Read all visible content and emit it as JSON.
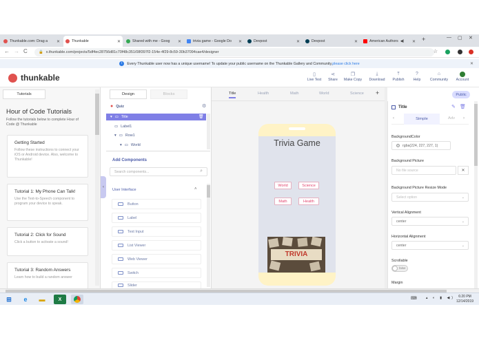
{
  "browser": {
    "tabs": [
      {
        "label": "Thunkable.com: Drag a",
        "color": "#e0524f"
      },
      {
        "label": "Thunkable",
        "color": "#e0524f",
        "active": true
      },
      {
        "label": "Shared with me - Goog",
        "color": "#34a853"
      },
      {
        "label": "trivia game - Google Do",
        "color": "#4285f4"
      },
      {
        "label": "Devpost",
        "color": "#003e54"
      },
      {
        "label": "Devpost",
        "color": "#003e54"
      },
      {
        "label": "American Authors",
        "color": "#ff0000"
      }
    ],
    "url": "x.thunkable.com/projects/5df4ec28756d81c70f48c351/08f397f2-154e-4f29-8c59-30b37094cae4/designer"
  },
  "notice": {
    "text": "Every Thunkable user now has a unique username! To update your public username on the Thunkable Gallery and Community, ",
    "link": "please click here"
  },
  "header": {
    "logo": "thunkable",
    "buttons": [
      "Live Test",
      "Share",
      "Make Copy",
      "Download",
      "Publish",
      "Help",
      "Community",
      "Account"
    ]
  },
  "tutorials": {
    "tab": "Tutorials",
    "title": "Hour of Code Tutorials",
    "subtitle": "Follow the tutorials below to complete Hour of Code @ Thunkable",
    "cards": [
      {
        "title": "Getting Started",
        "desc": "Follow these instructions to connect your iOS or Android device. Also, welcome to Thunkable!"
      },
      {
        "title": "Tutorial 1: My Phone Can Talk!",
        "desc": "Use the Text-to-Speech component to program your device to speak."
      },
      {
        "title": "Tutorial 2: Click for Sound",
        "desc": "Click a button to activate a sound!"
      },
      {
        "title": "Tutorial 3: Random Answers",
        "desc": "Learn how to build a random answer"
      }
    ]
  },
  "designer": {
    "tabs": [
      "Design",
      "Blocks"
    ],
    "app_name": "Quiz",
    "tree": [
      "Title",
      "Label1",
      "Row1",
      "World"
    ],
    "add_components": "Add Components",
    "search_placeholder": "Search components...",
    "section": "User Interface",
    "components": [
      "Button",
      "Label",
      "Text Input",
      "List Viewer",
      "Web Viewer",
      "Switch",
      "Slider"
    ]
  },
  "canvas": {
    "screens": [
      "Title",
      "Health",
      "Math",
      "World",
      "Science"
    ],
    "public_label": "Public",
    "app_title": "Trivia Game",
    "buttons": [
      "World",
      "Science",
      "Math",
      "Health"
    ],
    "image_text": "TRIVIA"
  },
  "properties": {
    "selected": "Title",
    "tabs": [
      "Simple",
      "Adv"
    ],
    "bgcolor_label": "BackgroundColor",
    "bgcolor_value": "rgba(224, 227, 227, 1)",
    "bgpic_label": "Background Picture",
    "bgpic_value": "No file source",
    "resize_label": "Background Picture Resize Mode",
    "resize_value": "Select option",
    "valign_label": "Vertical Alignment",
    "valign_value": "center",
    "halign_label": "Horizontal Alignment",
    "halign_value": "center",
    "scroll_label": "Scrollable",
    "scroll_value": "false",
    "margin_label": "Margin"
  },
  "taskbar": {
    "time": "6:20 PM",
    "date": "12/14/2019"
  }
}
